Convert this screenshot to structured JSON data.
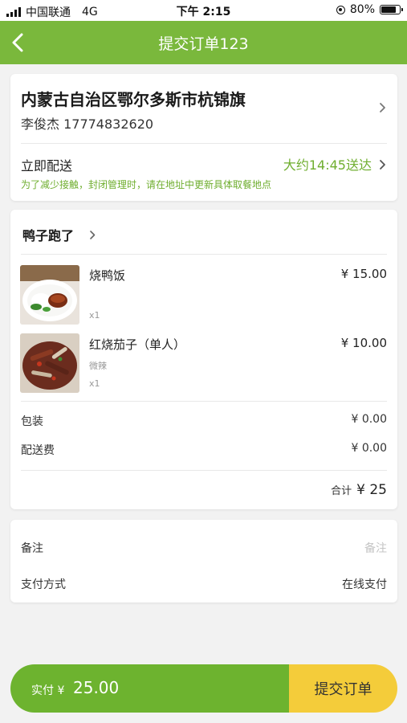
{
  "status_bar": {
    "carrier": "中国联通",
    "network": "4G",
    "time": "下午 2:15",
    "battery": "80%",
    "battery_level": 0.8
  },
  "header": {
    "title": "提交订单123",
    "back_icon": "chevron-left-icon"
  },
  "address": {
    "location": "内蒙古自治区鄂尔多斯市杭锦旗",
    "contact": "李俊杰 17774832620",
    "delivery_label": "立即配送",
    "delivery_time": "大约14:45送达",
    "delivery_note": "为了减少接触，封闭管理时，请在地址中更新具体取餐地点"
  },
  "order": {
    "shop_name": "鸭子跑了",
    "items": [
      {
        "name": "烧鸭饭",
        "price": "¥ 15.00",
        "spec": "",
        "qty": "x1"
      },
      {
        "name": "红烧茄子（单人）",
        "price": "¥ 10.00",
        "spec": "微辣",
        "qty": "x1"
      }
    ],
    "packaging_label": "包装",
    "packaging_value": "¥ 0.00",
    "delivery_fee_label": "配送费",
    "delivery_fee_value": "¥ 0.00",
    "total_label": "合计",
    "total_value": "¥ 25"
  },
  "extras": {
    "remark_label": "备注",
    "remark_placeholder": "备注",
    "payment_label": "支付方式",
    "payment_value": "在线支付"
  },
  "bottom": {
    "pay_label": "实付 ¥",
    "pay_amount": "25.00",
    "submit_label": "提交订单"
  },
  "colors": {
    "brand_green": "#7ab83c",
    "accent_green": "#6fae2f",
    "submit_yellow": "#f4cc3a"
  }
}
